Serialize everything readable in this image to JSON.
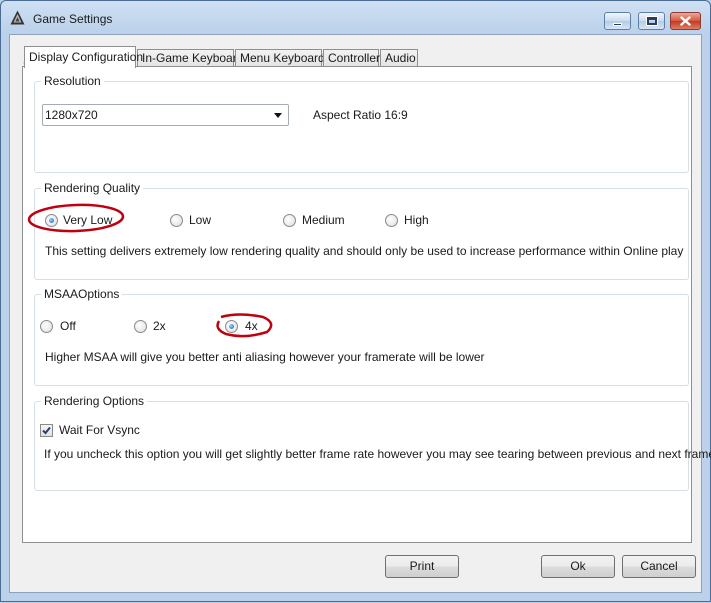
{
  "window": {
    "title": "Game Settings"
  },
  "tabs": [
    {
      "label": "Display Configuration",
      "active": true
    },
    {
      "label": "In-Game Keyboard",
      "active": false
    },
    {
      "label": "Menu Keyboard",
      "active": false
    },
    {
      "label": "Controller",
      "active": false
    },
    {
      "label": "Audio",
      "active": false
    }
  ],
  "resolution": {
    "title": "Resolution",
    "selected": "1280x720",
    "aspect": "Aspect Ratio 16:9"
  },
  "quality": {
    "title": "Rendering Quality",
    "options": [
      "Very Low",
      "Low",
      "Medium",
      "High"
    ],
    "selected": "Very Low",
    "description": "This setting delivers extremely low rendering quality and should only be used to increase performance within Online play"
  },
  "msaa": {
    "title": "MSAAOptions",
    "options": [
      "Off",
      "2x",
      "4x"
    ],
    "selected": "4x",
    "description": "Higher MSAA will give you better anti aliasing however your framerate will be lower"
  },
  "rendering_options": {
    "title": "Rendering Options",
    "vsync_label": "Wait For Vsync",
    "vsync_checked": true,
    "description": "If you uncheck this option you will get slightly better frame rate however you may see tearing between previous and next frames."
  },
  "buttons": {
    "print": "Print",
    "ok": "Ok",
    "cancel": "Cancel"
  },
  "colors": {
    "annotation": "#c0000f",
    "accent": "#1b5fa8"
  }
}
